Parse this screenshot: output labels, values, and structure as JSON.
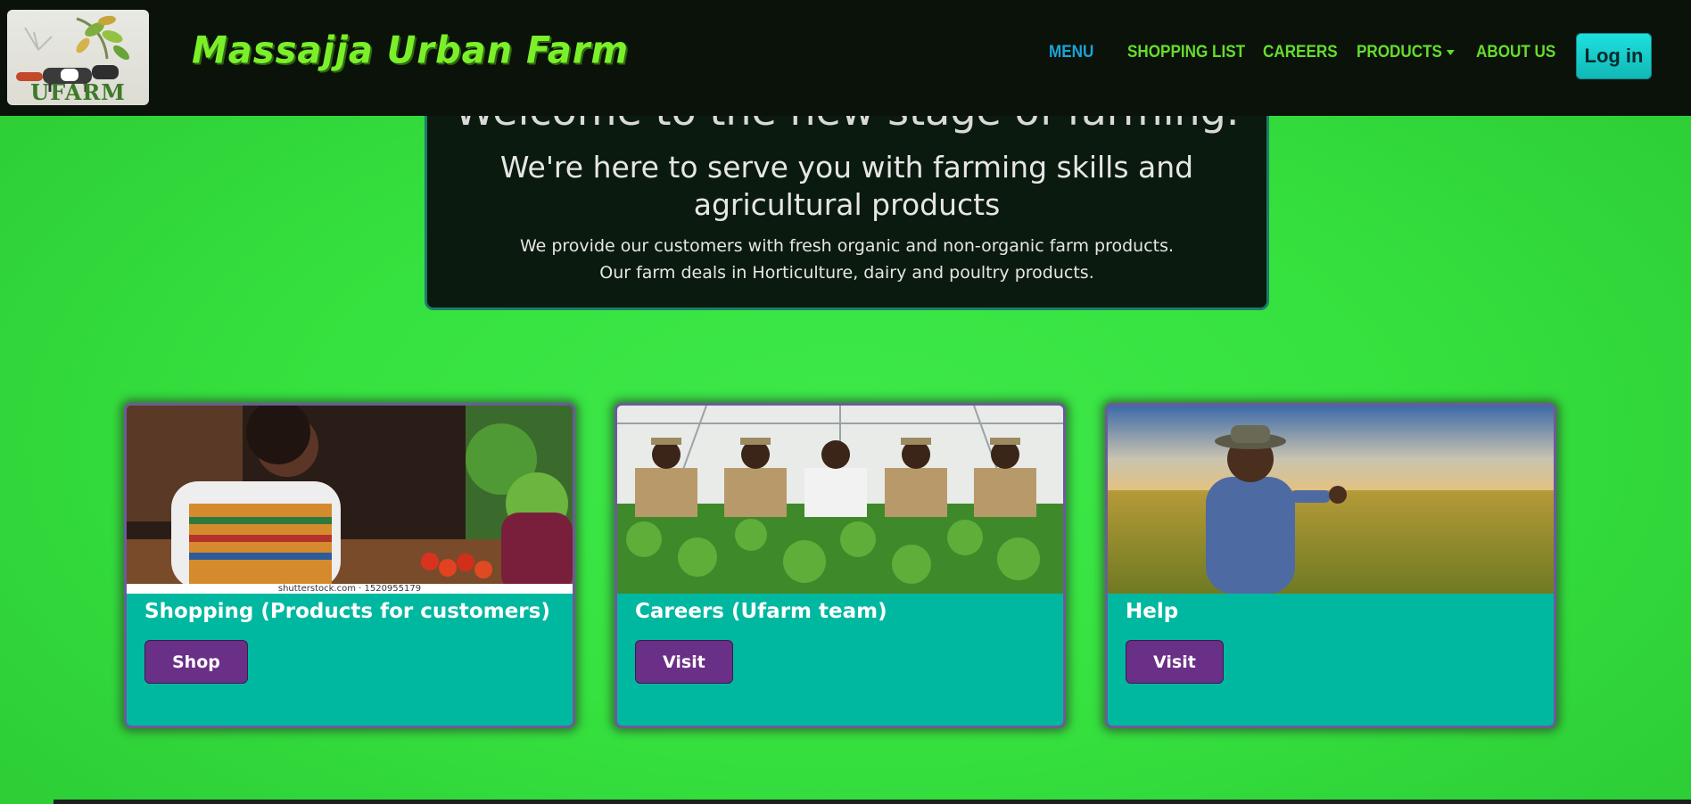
{
  "navbar": {
    "logo_text": "UFARM",
    "brand": "Massajja Urban Farm",
    "links": [
      {
        "label": "MENU",
        "active": true
      },
      {
        "label": "SHOPPING LIST"
      },
      {
        "label": "CAREERS"
      },
      {
        "label": "PRODUCTS"
      },
      {
        "label": "ABOUT US"
      }
    ],
    "login_label": "Log in"
  },
  "hero": {
    "title": "Welcome to the new stage of farming.",
    "subtitle": "We're here to serve you with farming skills and agricultural products",
    "paragraph_1": "We provide our customers with fresh organic and non-organic farm products.",
    "paragraph_2": "Our farm deals in Horticulture, dairy and poultry products."
  },
  "cards": [
    {
      "title": "Shopping (Products for customers)",
      "button": "Shop",
      "image_caption": "shutterstock.com · 1520955179"
    },
    {
      "title": "Careers (Ufarm team)",
      "button": "Visit"
    },
    {
      "title": "Help",
      "button": "Visit"
    }
  ],
  "colors": {
    "page_background": "#36e23f",
    "navbar": "#0a120a",
    "brand": "#7bf02a",
    "nav_link": "#66dd2c",
    "nav_link_active": "#1aa5d8",
    "login_button": "#1ad0cf",
    "hero_background": "#0b1a0e",
    "card_background": "#00b8a0",
    "card_button": "#6a2f86"
  },
  "icons": [
    "logo-image",
    "dropdown-caret-icon"
  ]
}
